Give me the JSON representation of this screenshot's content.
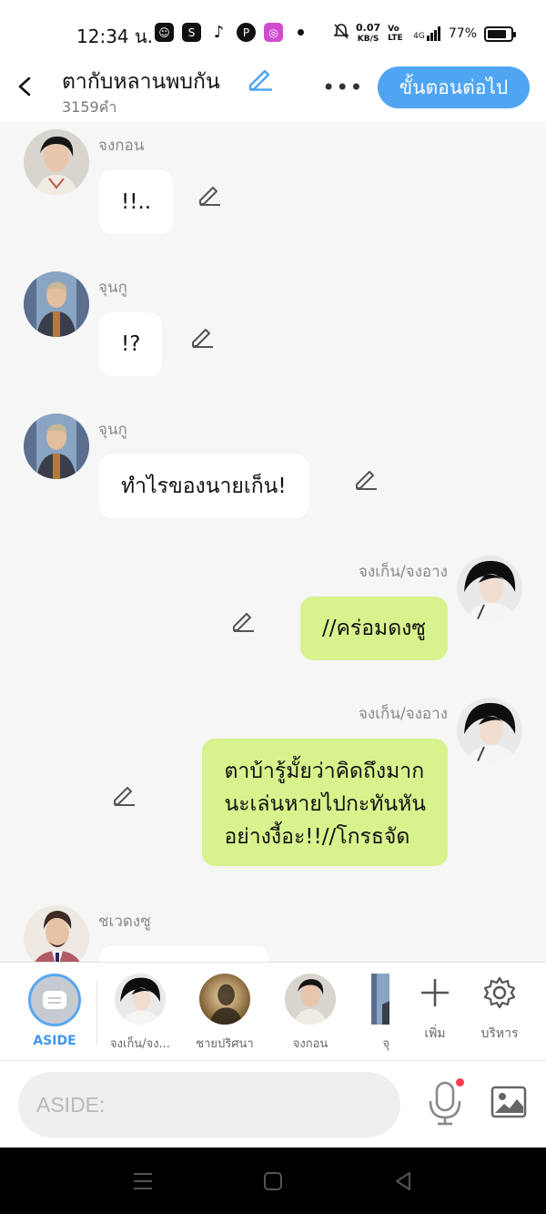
{
  "status_bar": {
    "time": "12:34 น.",
    "net_speed_value": "0.07",
    "net_speed_unit": "KB/S",
    "volte": "Vo LTE",
    "network": "4G",
    "battery": "77%",
    "app_icons": [
      "line-icon",
      "shopee-icon",
      "tiktok-icon",
      "pinterest-icon",
      "instagram-icon"
    ]
  },
  "header": {
    "title": "ตากับหลานพบกัน",
    "word_count": "3159คำ",
    "more_label": "•••",
    "next_button": "ขั้นตอนต่อไป"
  },
  "messages": [
    {
      "sender": "จงกอน",
      "text": "!!..",
      "side": "left",
      "avatar": "avatar-jonggun"
    },
    {
      "sender": "จุนกู",
      "text": "!?",
      "side": "left",
      "avatar": "avatar-jungu"
    },
    {
      "sender": "จุนกู",
      "text": "ทำไรของนายเก็น!",
      "side": "left",
      "avatar": "avatar-jungu"
    },
    {
      "sender": "จงเก็น/จงอาง",
      "text": "//คร่อมดงซู",
      "side": "right",
      "avatar": "avatar-jonggen"
    },
    {
      "sender": "จงเก็น/จงอาง",
      "text": "ตาบ้ารู้มั้ยว่าคิดถึงมาก\nนะเล่นหายไปกะทันหัน\nอย่างงี้อะ!!//โกรธจัด",
      "side": "right",
      "avatar": "avatar-jonggen"
    },
    {
      "sender": "ชเวดงซู",
      "text": "",
      "side": "left",
      "avatar": "avatar-choidongsu"
    }
  ],
  "character_bar": {
    "aside_label": "ASIDE",
    "characters": [
      {
        "label": "จงเก็น/จง..."
      },
      {
        "label": "ชายปริศนา"
      },
      {
        "label": "จงกอน"
      },
      {
        "label": "จุ"
      }
    ],
    "add_label": "เพิ่ม",
    "manage_label": "บริหาร"
  },
  "input_bar": {
    "placeholder": "ASIDE:",
    "mic_badge_color": "#ff3b4e"
  },
  "colors": {
    "accent": "#4fa5f2",
    "right_bubble": "#d8f28d",
    "left_bubble": "#ffffff",
    "background": "#f6f6f6"
  }
}
